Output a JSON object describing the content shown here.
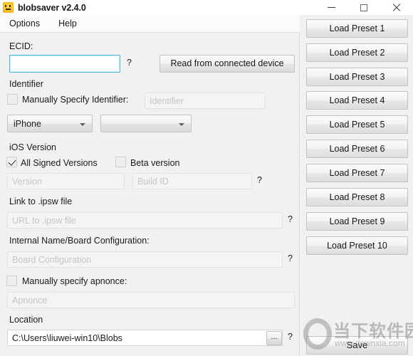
{
  "window": {
    "title": "blobsaver v2.4.0",
    "icon": "app-face-icon",
    "controls": {
      "minimize": "minimize-icon",
      "maximize": "maximize-icon",
      "close": "close-icon"
    }
  },
  "menubar": {
    "items": [
      {
        "label": "Options"
      },
      {
        "label": "Help"
      }
    ]
  },
  "form": {
    "ecid": {
      "label": "ECID:",
      "value": "",
      "placeholder": "",
      "help": "?",
      "focused": true
    },
    "read_device_button": "Read from connected device",
    "identifier": {
      "section_label": "Identifier",
      "checkbox_label": "Manually Specify Identifier:",
      "checked": false,
      "value": "",
      "placeholder": "Identifier"
    },
    "device_type": {
      "selected": "iPhone",
      "arrow": "chevron-down-icon"
    },
    "device_model": {
      "selected": "",
      "arrow": "chevron-down-icon"
    },
    "ios_version": {
      "section_label": "iOS Version",
      "all_signed_label": "All Signed Versions",
      "all_signed_checked": true,
      "beta_label": "Beta version",
      "beta_checked": false,
      "version_value": "",
      "version_placeholder": "Version",
      "build_value": "",
      "build_placeholder": "Build ID",
      "help": "?"
    },
    "ipsw": {
      "label": "Link to .ipsw file",
      "value": "",
      "placeholder": "URL to .ipsw file",
      "help": "?"
    },
    "board_config": {
      "label": "Internal Name/Board Configuration:",
      "value": "",
      "placeholder": "Board Configuration",
      "help": "?"
    },
    "apnonce": {
      "checkbox_label": "Manually specify apnonce:",
      "checked": false,
      "value": "",
      "placeholder": "Apnonce"
    },
    "location": {
      "label": "Location",
      "value": "C:\\Users\\liuwei-win10\\Blobs",
      "placeholder": "",
      "browse_label": "...",
      "help": "?"
    }
  },
  "presets": {
    "buttons": [
      "Load Preset 1",
      "Load Preset 2",
      "Load Preset 3",
      "Load Preset 4",
      "Load Preset 5",
      "Load Preset 6",
      "Load Preset 7",
      "Load Preset 8",
      "Load Preset 9",
      "Load Preset 10"
    ],
    "save_label": "Save"
  },
  "watermark": {
    "text_cn": "当下软件园",
    "url": "www.downxia.com",
    "logo": "downxia-ring-logo"
  },
  "colors": {
    "window_bg": "#f1f1f1",
    "titlebar_bg": "#ffffff",
    "focus_border": "#4fb3e8",
    "field_bg": "#fdfdfd",
    "text": "#1b1b1b",
    "placeholder": "#c5c5c5"
  }
}
